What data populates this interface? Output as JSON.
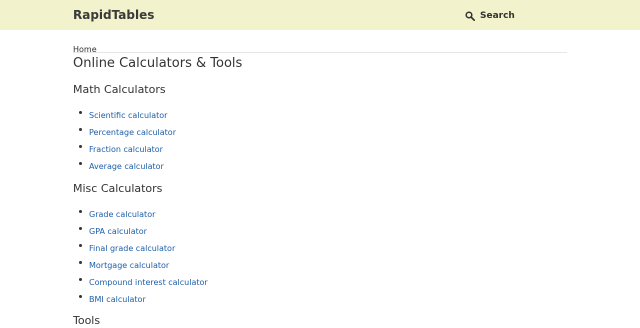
{
  "header": {
    "brand": "RapidTables",
    "search_label": "Search",
    "search_icon": "search-icon",
    "background": "#f2f2cc"
  },
  "breadcrumb": {
    "home": "Home"
  },
  "page": {
    "title": "Online Calculators & Tools"
  },
  "sections": {
    "math": {
      "heading": "Math Calculators",
      "items": [
        "Scientific calculator",
        "Percentage calculator",
        "Fraction calculator",
        "Average calculator"
      ]
    },
    "misc": {
      "heading": "Misc Calculators",
      "items": [
        "Grade calculator",
        "GPA calculator",
        "Final grade calculator",
        "Mortgage calculator",
        "Compound interest calculator",
        "BMI calculator"
      ]
    },
    "tools": {
      "heading": "Tools"
    }
  },
  "colors": {
    "link": "#1f5fa8",
    "text": "#333333"
  }
}
